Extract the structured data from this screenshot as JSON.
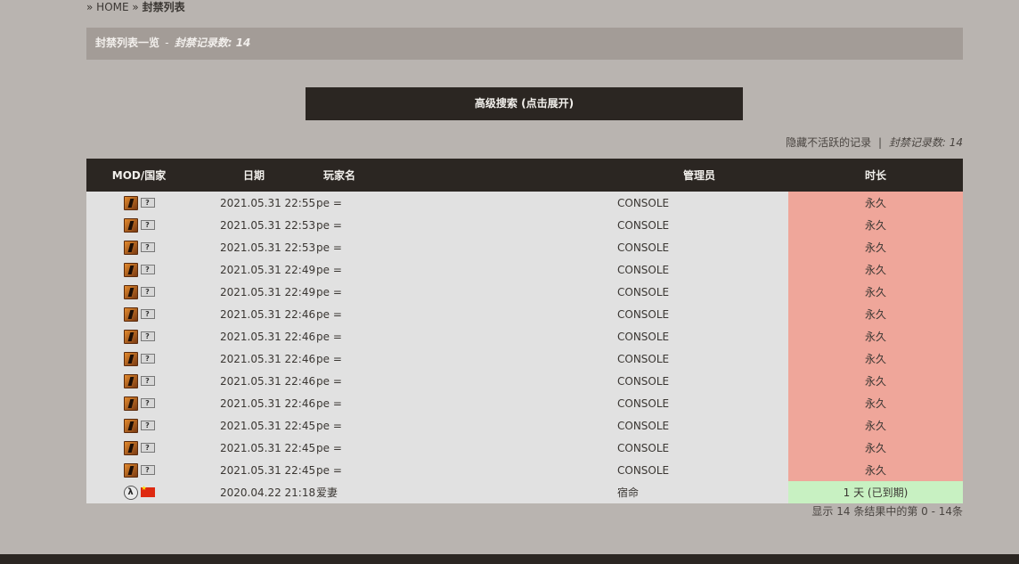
{
  "breadcrumb": {
    "sep1": "»",
    "home": "HOME",
    "sep2": "»",
    "current": "封禁列表"
  },
  "titlebar": {
    "title": "封禁列表一览",
    "sep": "-",
    "count_label": "封禁记录数: 14"
  },
  "advanced_search": {
    "label": "高级搜索 (点击展开)"
  },
  "summary": {
    "hide_inactive": "隐藏不活跃的记录",
    "pipe": "|",
    "count_label": "封禁记录数: 14"
  },
  "table": {
    "headers": {
      "mod": "MOD/国家",
      "date": "日期",
      "name": "玩家名",
      "admin": "管理员",
      "length": "时长"
    },
    "rows": [
      {
        "game_icon": "cs-icon",
        "country_icon": "unknown-flag-icon",
        "date": "2021.05.31 22:55",
        "name": "pe =",
        "admin": "CONSOLE",
        "length": "永久",
        "status": "permanent"
      },
      {
        "game_icon": "cs-icon",
        "country_icon": "unknown-flag-icon",
        "date": "2021.05.31 22:53",
        "name": "pe =",
        "admin": "CONSOLE",
        "length": "永久",
        "status": "permanent"
      },
      {
        "game_icon": "cs-icon",
        "country_icon": "unknown-flag-icon",
        "date": "2021.05.31 22:53",
        "name": "pe =",
        "admin": "CONSOLE",
        "length": "永久",
        "status": "permanent"
      },
      {
        "game_icon": "cs-icon",
        "country_icon": "unknown-flag-icon",
        "date": "2021.05.31 22:49",
        "name": "pe =",
        "admin": "CONSOLE",
        "length": "永久",
        "status": "permanent"
      },
      {
        "game_icon": "cs-icon",
        "country_icon": "unknown-flag-icon",
        "date": "2021.05.31 22:49",
        "name": "pe =",
        "admin": "CONSOLE",
        "length": "永久",
        "status": "permanent"
      },
      {
        "game_icon": "cs-icon",
        "country_icon": "unknown-flag-icon",
        "date": "2021.05.31 22:46",
        "name": "pe =",
        "admin": "CONSOLE",
        "length": "永久",
        "status": "permanent"
      },
      {
        "game_icon": "cs-icon",
        "country_icon": "unknown-flag-icon",
        "date": "2021.05.31 22:46",
        "name": "pe =",
        "admin": "CONSOLE",
        "length": "永久",
        "status": "permanent"
      },
      {
        "game_icon": "cs-icon",
        "country_icon": "unknown-flag-icon",
        "date": "2021.05.31 22:46",
        "name": "pe =",
        "admin": "CONSOLE",
        "length": "永久",
        "status": "permanent"
      },
      {
        "game_icon": "cs-icon",
        "country_icon": "unknown-flag-icon",
        "date": "2021.05.31 22:46",
        "name": "pe =",
        "admin": "CONSOLE",
        "length": "永久",
        "status": "permanent"
      },
      {
        "game_icon": "cs-icon",
        "country_icon": "unknown-flag-icon",
        "date": "2021.05.31 22:46",
        "name": "pe =",
        "admin": "CONSOLE",
        "length": "永久",
        "status": "permanent"
      },
      {
        "game_icon": "cs-icon",
        "country_icon": "unknown-flag-icon",
        "date": "2021.05.31 22:45",
        "name": "pe =",
        "admin": "CONSOLE",
        "length": "永久",
        "status": "permanent"
      },
      {
        "game_icon": "cs-icon",
        "country_icon": "unknown-flag-icon",
        "date": "2021.05.31 22:45",
        "name": "pe =",
        "admin": "CONSOLE",
        "length": "永久",
        "status": "permanent"
      },
      {
        "game_icon": "cs-icon",
        "country_icon": "unknown-flag-icon",
        "date": "2021.05.31 22:45",
        "name": "pe =",
        "admin": "CONSOLE",
        "length": "永久",
        "status": "permanent"
      },
      {
        "game_icon": "half-life-icon",
        "country_icon": "china-flag-icon",
        "date": "2020.04.22 21:18",
        "name": "爱妻",
        "admin": "宿命",
        "length": "1 天 (已到期)",
        "status": "expired"
      }
    ]
  },
  "pager": {
    "text": "显示 14 条结果中的第 0 - 14条"
  },
  "colors": {
    "background": "#b9b4b0",
    "header_dark": "#2b2622",
    "titlebar": "#a39c97",
    "row_bg": "#e1e1e1",
    "permanent": "#efa69a",
    "expired": "#c8f1c2"
  }
}
